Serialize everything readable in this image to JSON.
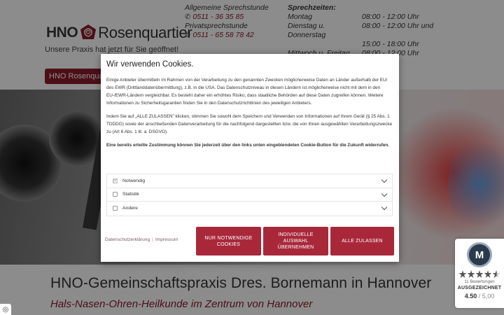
{
  "header": {
    "logo_hno": "HNO",
    "logo_name": "Rosenquartier",
    "tagline": "Unsere Praxis hat jetzt für Sie geöffnet!",
    "general_label": "Allgemeine Sprechstunde",
    "general_phone": "0511 - 36 35 85",
    "private_label": "Privatsprechstunde",
    "private_phone": "0511 - 65 58 78 42",
    "hours_title": "Sprechzeiten:",
    "hours": [
      {
        "day": "Montag",
        "time": "08:00 - 12:00 Uhr"
      },
      {
        "day": "Dienstag u. Donnerstag",
        "time": "08:00 - 12:00 Uhr und"
      },
      {
        "day": "",
        "time": "15:00 - 18:00 Uhr"
      },
      {
        "day": "Mittwoch u. Freitag",
        "time": "08:00 - 12:00 Uhr"
      }
    ],
    "nav_label": "HNO Rosenquartier"
  },
  "hero": {
    "title": "HNO-Gemeinschaftspraxis Dres. Bornemann in Hannover",
    "subtitle": "Hals-Nasen-Ohren-Heilkunde im Zentrum von Hannover"
  },
  "rating": {
    "badge": "M",
    "count": "11 Bewertungen",
    "label": "AUSGEZEICHNET",
    "score": "4.50",
    "max": "/ 5,00",
    "stars": 4.5
  },
  "cookie": {
    "title": "Wir verwenden Cookies.",
    "para1": "Einige Anbieter übermitteln im Rahmen von der Verarbeitung zu den genannten Zwecken möglicherweise Daten an Länder außerhalb der EU/ des EWR (Drittlanddatenübermittlung), z.B. in die USA. Das Datenschutzniveau in diesen Ländern ist möglicherweise nicht mit dem in den EU-/EWR-Ländern vergleichbar. Es besteht daher ein erhöhtes Risiko, dass staatliche Behörden auf diese Daten zugreifen können. Weitere Informationen zu Sicherheitsgarantien finden Sie in den Datenschutzrichtlinien des jeweiligen Anbieters.",
    "para2": "Indem Sie auf „ALLE ZULASSEN\" klicken, stimmen Sie sowohl dem Speichern und Verwenden von Informationen auf Ihrem Gerät (§ 25 Abs. 1 TDDDG) sowie der anschließenden Datenverarbeitung für die nachfolgend dargestellten bzw. die von Ihnen ausgewählten Verarbeitungszwecke zu (Art 6 Abs. 1 lit. a. DSGVO).",
    "para3": "Eine bereits erteilte Zustimmung können Sie jederzeit über den links unten eingeblendeten Cookie-Button für die Zukunft widerrufen.",
    "categories": [
      {
        "label": "Notwendig",
        "checked": true
      },
      {
        "label": "Statistik",
        "checked": false
      },
      {
        "label": "Andere",
        "checked": false
      }
    ],
    "privacy_link": "Datenschutzerklärung",
    "separator": "|",
    "imprint_link": "Impressum",
    "btn_necessary": "NUR NOTWENDIGE COOKIES",
    "btn_individual": "INDIVIDUELLE AUSWAHL ÜBERNEHMEN",
    "btn_all": "ALLE ZULASSEN"
  },
  "colors": {
    "brand": "#8a1c2b",
    "button": "#a8283a"
  }
}
